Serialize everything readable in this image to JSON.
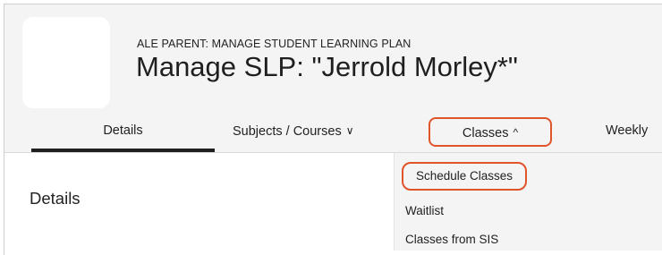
{
  "header": {
    "subtitle": "ALE PARENT: MANAGE STUDENT LEARNING PLAN",
    "title": "Manage SLP: \"Jerrold Morley*\""
  },
  "tabs": [
    {
      "label": "Details",
      "active": true
    },
    {
      "label": "Subjects / Courses",
      "chevron": "chevron-down-icon"
    },
    {
      "label": "Classes",
      "chevron": "chevron-up-icon",
      "highlighted": true
    },
    {
      "label": "Weekly"
    }
  ],
  "chevrons": {
    "down": "∨",
    "up": "^"
  },
  "section": {
    "title": "Details"
  },
  "classes_menu": {
    "items": [
      "Schedule Classes",
      "Waitlist",
      "Classes from SIS"
    ]
  },
  "colors": {
    "highlight": "#e0542b",
    "header_bg": "#f4f4f4",
    "active_underline": "#1f1f1f"
  }
}
